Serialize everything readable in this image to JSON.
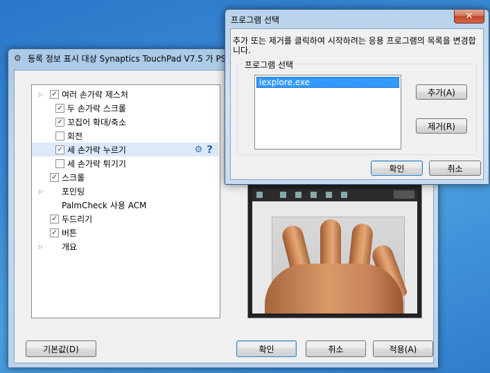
{
  "main_window": {
    "title": "등록 정보 표시 대상 Synaptics TouchPad V7.5 가 PS/",
    "tree": [
      {
        "label": "여러 손가락 제스처",
        "level": 0,
        "expander": true,
        "checkbox": true,
        "checked": true
      },
      {
        "label": "두 손가락 스크롤",
        "level": 1,
        "checkbox": true,
        "checked": true
      },
      {
        "label": "꼬집어 확대/축소",
        "level": 1,
        "checkbox": true,
        "checked": true
      },
      {
        "label": "회전",
        "level": 1,
        "checkbox": true,
        "checked": false
      },
      {
        "label": "세 손가락 누르기",
        "level": 1,
        "checkbox": true,
        "checked": true,
        "selected": true
      },
      {
        "label": "세 손가락 튀기기",
        "level": 1,
        "checkbox": true,
        "checked": false
      },
      {
        "label": "스크롤",
        "level": 0,
        "checkbox": true,
        "checked": true
      },
      {
        "label": "포인팅",
        "level": 0,
        "expander": true,
        "checkbox": false
      },
      {
        "label": "PalmCheck 사용 ACM",
        "level": 0,
        "checkbox": false
      },
      {
        "label": "두드리기",
        "level": 0,
        "checkbox": true,
        "checked": true
      },
      {
        "label": "버튼",
        "level": 0,
        "checkbox": true,
        "checked": true
      },
      {
        "label": "개요",
        "level": 0,
        "expander": true,
        "checkbox": false
      }
    ],
    "buttons": {
      "defaults": "기본값(D)",
      "ok": "확인",
      "cancel": "취소",
      "apply": "적용(A)"
    },
    "check_glyph": "✓",
    "expander_glyph": "▷",
    "help_glyph": "?",
    "icons": {
      "settings": "gear-icon",
      "help": "help-icon",
      "app": "touchpad-icon"
    }
  },
  "dialog": {
    "title": "프로그램 선택",
    "description": "추가 또는 제거를 클릭하여 시작하려는 응용 프로그램의 목록을 변경합니다.",
    "group_label": "프로그램 선택",
    "programs": [
      "iexplore.exe"
    ],
    "add_button": "추가(A)",
    "remove_button": "제거(R)",
    "ok_button": "확인",
    "cancel_button": "취소",
    "close_glyph": "✕"
  }
}
